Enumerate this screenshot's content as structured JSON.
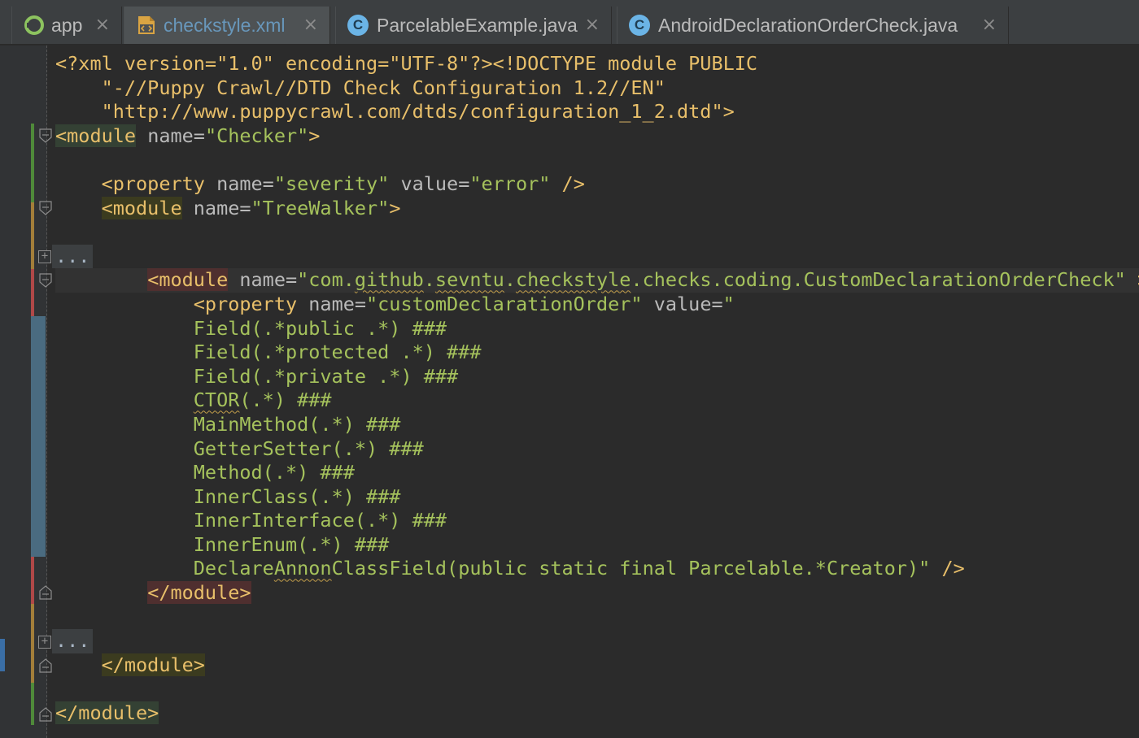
{
  "tabs": [
    {
      "label": "app",
      "icon": "android-module-icon",
      "active": false
    },
    {
      "label": "checkstyle.xml",
      "icon": "xml-file-icon",
      "active": true
    },
    {
      "label": "ParcelableExample.java",
      "icon": "java-class-icon",
      "active": false
    },
    {
      "label": "AndroidDeclarationOrderCheck.java",
      "icon": "java-class-icon",
      "active": false
    }
  ],
  "close_glyph": "×",
  "class_icon_letter": "C",
  "fold_placeholder": "...",
  "fold_expand_glyph": "+",
  "colors": {
    "background": "#2b2b2b",
    "tag": "#e8bf6a",
    "attribute": "#bababa",
    "value": "#a5c25c",
    "active_tab_text": "#6897bb",
    "change_added": "#4f8a3a",
    "change_modified": "#a37e3a",
    "change_removed": "#b04848"
  },
  "editor": {
    "lines": [
      {
        "segments": [
          {
            "t": "<?xml version=\"1.0\" encoding=\"UTF-8\"?><!DOCTYPE module PUBLIC",
            "c": "decl"
          }
        ]
      },
      {
        "segments": [
          {
            "t": "    \"-//Puppy Crawl//DTD Check Configuration 1.2//EN\"",
            "c": "decl"
          }
        ]
      },
      {
        "segments": [
          {
            "t": "    \"http://www.puppycrawl.com/dtds/configuration_1_2.dtd\">",
            "c": "decl"
          }
        ]
      },
      {
        "segments": [
          {
            "t": "<module",
            "c": "tag",
            "hl": "green"
          },
          {
            "t": " name=",
            "c": "attr"
          },
          {
            "t": "\"Checker\"",
            "c": "val"
          },
          {
            "t": ">",
            "c": "tag"
          }
        ]
      },
      {
        "segments": [
          {
            "t": "",
            "c": "attr"
          }
        ]
      },
      {
        "segments": [
          {
            "t": "    ",
            "c": "attr"
          },
          {
            "t": "<property",
            "c": "tag"
          },
          {
            "t": " name=",
            "c": "attr"
          },
          {
            "t": "\"severity\"",
            "c": "val"
          },
          {
            "t": " value=",
            "c": "attr"
          },
          {
            "t": "\"error\"",
            "c": "val"
          },
          {
            "t": " />",
            "c": "tag"
          }
        ]
      },
      {
        "segments": [
          {
            "t": "    ",
            "c": "attr"
          },
          {
            "t": "<module",
            "c": "tag",
            "hl": "olive"
          },
          {
            "t": " name=",
            "c": "attr"
          },
          {
            "t": "\"TreeWalker\"",
            "c": "val"
          },
          {
            "t": ">",
            "c": "tag"
          }
        ]
      },
      {
        "segments": [
          {
            "t": "",
            "c": "attr"
          }
        ]
      },
      {
        "fold": true,
        "segments": [
          {
            "t": "",
            "c": "attr"
          }
        ]
      },
      {
        "caret": true,
        "segments": [
          {
            "t": "        ",
            "c": "attr"
          },
          {
            "t": "<module",
            "c": "tag",
            "hl": "red"
          },
          {
            "t": " name=",
            "c": "attr"
          },
          {
            "t": "\"com.",
            "c": "val"
          },
          {
            "t": "github",
            "c": "val",
            "sq": true
          },
          {
            "t": ".",
            "c": "val"
          },
          {
            "t": "sevntu",
            "c": "val",
            "sq": true
          },
          {
            "t": ".",
            "c": "val"
          },
          {
            "t": "checkstyle",
            "c": "val",
            "sq": true
          },
          {
            "t": ".checks.coding.CustomDeclarationOrderCheck\"",
            "c": "val"
          },
          {
            "t": " >",
            "c": "tag"
          }
        ]
      },
      {
        "segments": [
          {
            "t": "            ",
            "c": "attr"
          },
          {
            "t": "<property",
            "c": "tag"
          },
          {
            "t": " name=",
            "c": "attr"
          },
          {
            "t": "\"customDeclarationOrder\"",
            "c": "val"
          },
          {
            "t": " value=",
            "c": "attr"
          },
          {
            "t": "\"",
            "c": "val"
          }
        ]
      },
      {
        "segments": [
          {
            "t": "            Field(.*public .*) ###",
            "c": "val"
          }
        ]
      },
      {
        "segments": [
          {
            "t": "            Field(.*protected .*) ###",
            "c": "val"
          }
        ]
      },
      {
        "segments": [
          {
            "t": "            Field(.*private .*) ###",
            "c": "val"
          }
        ]
      },
      {
        "segments": [
          {
            "t": "            ",
            "c": "val"
          },
          {
            "t": "CTOR",
            "c": "val",
            "sq": true
          },
          {
            "t": "(.*) ###",
            "c": "val"
          }
        ]
      },
      {
        "segments": [
          {
            "t": "            MainMethod(.*) ###",
            "c": "val"
          }
        ]
      },
      {
        "segments": [
          {
            "t": "            GetterSetter(.*) ###",
            "c": "val"
          }
        ]
      },
      {
        "segments": [
          {
            "t": "            Method(.*) ###",
            "c": "val"
          }
        ]
      },
      {
        "segments": [
          {
            "t": "            InnerClass(.*) ###",
            "c": "val"
          }
        ]
      },
      {
        "segments": [
          {
            "t": "            InnerInterface(.*) ###",
            "c": "val"
          }
        ]
      },
      {
        "segments": [
          {
            "t": "            InnerEnum(.*) ###",
            "c": "val"
          }
        ]
      },
      {
        "segments": [
          {
            "t": "            Declare",
            "c": "val"
          },
          {
            "t": "Annon",
            "c": "val",
            "sq": true
          },
          {
            "t": "ClassField(public static final Parcelable.*Creator)\"",
            "c": "val"
          },
          {
            "t": " />",
            "c": "tag"
          }
        ]
      },
      {
        "segments": [
          {
            "t": "        ",
            "c": "attr"
          },
          {
            "t": "</module>",
            "c": "tag",
            "hl": "red"
          }
        ]
      },
      {
        "segments": [
          {
            "t": "",
            "c": "attr"
          }
        ]
      },
      {
        "fold": true,
        "segments": [
          {
            "t": "",
            "c": "attr"
          }
        ]
      },
      {
        "segments": [
          {
            "t": "    ",
            "c": "attr"
          },
          {
            "t": "</module>",
            "c": "tag",
            "hl": "olive"
          }
        ]
      },
      {
        "segments": [
          {
            "t": "",
            "c": "attr"
          }
        ]
      },
      {
        "segments": [
          {
            "t": "</module>",
            "c": "tag",
            "hl": "green"
          }
        ]
      }
    ]
  }
}
